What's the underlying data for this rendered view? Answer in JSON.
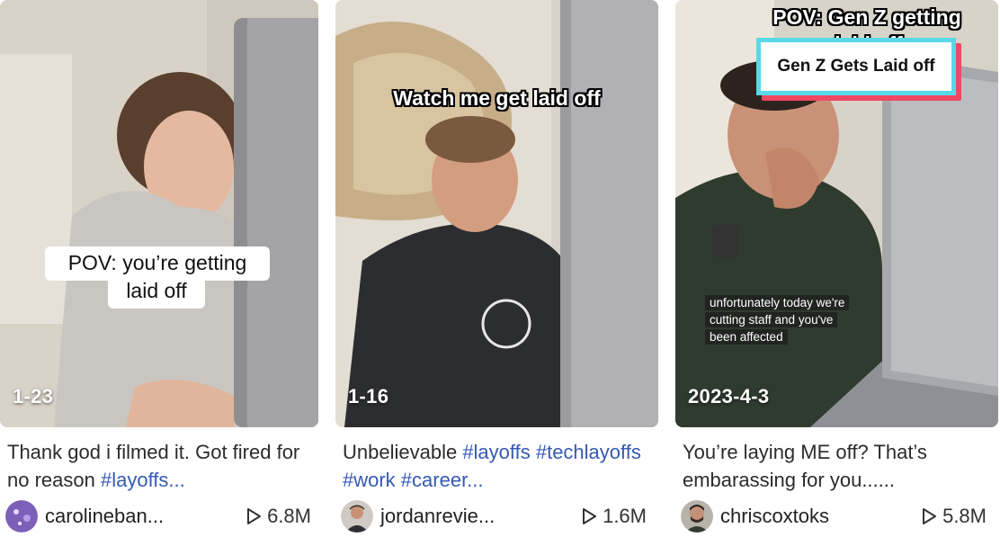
{
  "videos": [
    {
      "date": "1-23",
      "overlay": [
        "POV: you’re getting",
        "laid off"
      ],
      "desc_text": "Thank god i filmed it. Got fired for no reason ",
      "desc_tag": "#layoffs...",
      "username": "carolineban...",
      "views": "6.8M",
      "avatar_icon": "purple-sparkle-avatar"
    },
    {
      "date": "1-16",
      "overlay": [
        "Watch me get laid off"
      ],
      "desc_text": "Unbelievable ",
      "desc_tag": "#layoffs #techlayoffs #work #career...",
      "username": "jordanrevie...",
      "views": "1.6M",
      "avatar_icon": "man-portrait-avatar"
    },
    {
      "date": "2023-4-3",
      "overlay": [
        "POV: Gen Z getting",
        "laid off"
      ],
      "banner": "Gen Z Gets Laid off",
      "subtitle": [
        "unfortunately today we're",
        "cutting staff and you've",
        "been affected"
      ],
      "desc_text": "You’re laying ME off? That’s embarassing for you......",
      "desc_tag": "",
      "username": "chriscoxtoks",
      "views": "5.8M",
      "avatar_icon": "man-portrait-avatar"
    }
  ],
  "colors": {
    "hashtag": "#3559b5",
    "banner_border": "#59d8e8",
    "banner_shadow": "#f04763"
  }
}
